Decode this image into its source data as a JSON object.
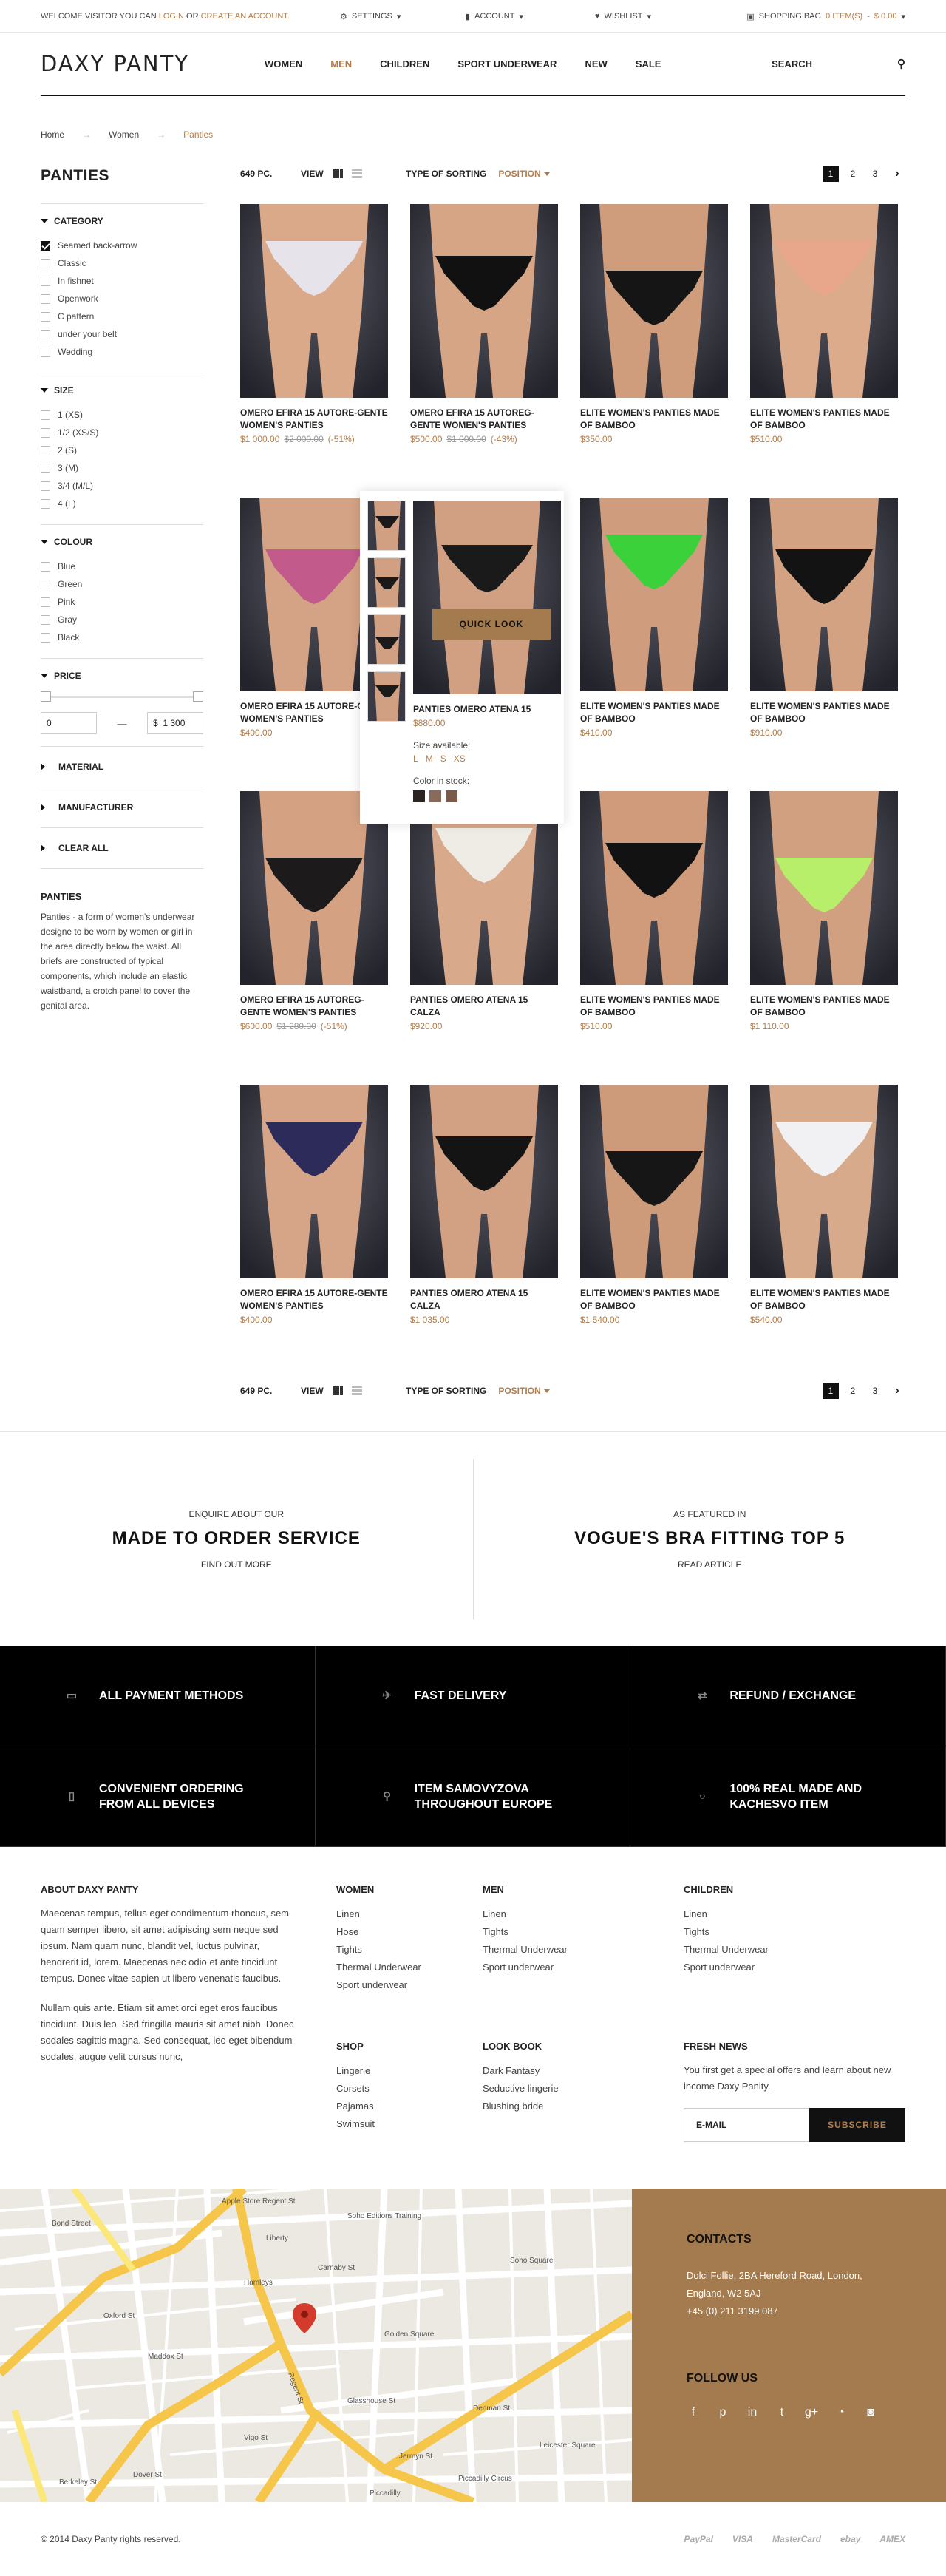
{
  "topbar": {
    "welcome_pre": "WELCOME VISITOR YOU CAN",
    "login": "LOGIN",
    "or": "OR",
    "create_account": "CREATE AN ACCOUNT.",
    "settings": "SETTINGS",
    "account": "ACCOUNT",
    "wishlist": "WISHLIST",
    "bag_label": "SHOPPING BAG",
    "bag_count": "0 ITEM(S)",
    "bag_total": "$ 0.00"
  },
  "header": {
    "logo": "DAXY PANTY",
    "nav": [
      "WOMEN",
      "MEN",
      "CHILDREN",
      "SPORT UNDERWEAR",
      "NEW",
      "SALE"
    ],
    "search": "SEARCH"
  },
  "breadcrumb": [
    "Home",
    "Women",
    "Panties"
  ],
  "sidebar": {
    "title": "PANTIES",
    "category": {
      "title": "CATEGORY",
      "items": [
        "Seamed back-arrow",
        "Classic",
        "In fishnet",
        "Openwork",
        "C pattern",
        "under your belt",
        "Wedding"
      ]
    },
    "size": {
      "title": "SIZE",
      "items": [
        "1 (XS)",
        "1/2 (XS/S)",
        "2 (S)",
        "3 (M)",
        "3/4 (M/L)",
        "4 (L)"
      ]
    },
    "colour": {
      "title": "COLOUR",
      "items": [
        "Blue",
        "Green",
        "Pink",
        "Gray",
        "Black"
      ]
    },
    "price": {
      "title": "PRICE",
      "min": "0",
      "max_currency": "$",
      "max": "1 300"
    },
    "material": "MATERIAL",
    "manufacturer": "MANUFACTURER",
    "clear": "CLEAR ALL",
    "about_title": "PANTIES",
    "about_text": "Panties - a form of women's underwear designe to be worn by women or girl in the area directly below the waist. All briefs are constructed of typical components, which include an elastic waistband, a crotch panel to cover the genital area."
  },
  "toolbar": {
    "count": "649 PC.",
    "view": "VIEW",
    "sort_label": "TYPE OF SORTING",
    "sort_value": "POSITION",
    "pages": [
      "1",
      "2",
      "3"
    ],
    "next": "›"
  },
  "products": [
    {
      "name": "OMERO EFIRA 15 AUTORE-GENTE WOMEN'S PANTIES",
      "price": "$1 000.00",
      "old": "$2 000.00",
      "disc": "(-51%)",
      "color": "#e7e3ea",
      "skin": "#d9a98a"
    },
    {
      "name": "OMERO EFIRA 15 AUTOREG-GENTE WOMEN'S PANTIES",
      "price": "$500.00",
      "old": "$1 000.00",
      "disc": "(-43%)",
      "color": "#111111",
      "skin": "#d6a586"
    },
    {
      "name": "ELITE WOMEN'S PANTIES MADE OF BAMBOO",
      "price": "$350.00",
      "old": "",
      "disc": "",
      "color": "#151515",
      "skin": "#cf9c7c"
    },
    {
      "name": "ELITE WOMEN'S PANTIES MADE OF BAMBOO",
      "price": "$510.00",
      "old": "",
      "disc": "",
      "color": "#e8a78b",
      "skin": "#dcab8c"
    },
    {
      "name": "OMERO EFIRA 15 AUTORE-GENTE WOMEN'S PANTIES",
      "price": "$400.00",
      "old": "",
      "disc": "",
      "color": "#c25a8c",
      "skin": "#d4a385"
    },
    {
      "name": "PANTIES OMERO ATENA 15",
      "price": "$880.00",
      "old": "",
      "disc": "",
      "color": "#1a1a1a",
      "skin": "#d1a082"
    },
    {
      "name": "ELITE WOMEN'S PANTIES MADE OF BAMBOO",
      "price": "$410.00",
      "old": "",
      "disc": "",
      "color": "#3bd13b",
      "skin": "#cf9d7e"
    },
    {
      "name": "ELITE WOMEN'S PANTIES MADE OF BAMBOO",
      "price": "$910.00",
      "old": "",
      "disc": "",
      "color": "#131313",
      "skin": "#d2a283"
    },
    {
      "name": "OMERO EFIRA 15 AUTOREG-GENTE WOMEN'S PANTIES",
      "price": "$600.00",
      "old": "$1 280.00",
      "disc": "(-51%)",
      "color": "#1d1a1c",
      "skin": "#d4a283"
    },
    {
      "name": "PANTIES OMERO ATENA 15 CALZA",
      "price": "$920.00",
      "old": "",
      "disc": "",
      "color": "#efece6",
      "skin": "#d8a98b"
    },
    {
      "name": "ELITE WOMEN'S PANTIES MADE OF BAMBOO",
      "price": "$510.00",
      "old": "",
      "disc": "",
      "color": "#121212",
      "skin": "#cf9b7b"
    },
    {
      "name": "ELITE WOMEN'S PANTIES MADE OF BAMBOO",
      "price": "$1 110.00",
      "old": "",
      "disc": "",
      "color": "#b8ef6a",
      "skin": "#d1a081"
    },
    {
      "name": "OMERO EFIRA 15 AUTORE-GENTE WOMEN'S PANTIES",
      "price": "$400.00",
      "old": "",
      "disc": "",
      "color": "#2c2b5a",
      "skin": "#d6a587"
    },
    {
      "name": "PANTIES OMERO ATENA 15 CALZA",
      "price": "$1 035.00",
      "old": "",
      "disc": "",
      "color": "#141414",
      "skin": "#d2a083"
    },
    {
      "name": "ELITE WOMEN'S PANTIES MADE OF BAMBOO",
      "price": "$1 540.00",
      "old": "",
      "disc": "",
      "color": "#161616",
      "skin": "#cd9a7a"
    },
    {
      "name": "ELITE WOMEN'S PANTIES MADE OF BAMBOO",
      "price": "$540.00",
      "old": "",
      "disc": "",
      "color": "#f1f1f4",
      "skin": "#d8aa8c"
    }
  ],
  "quicklook": {
    "button": "QUICK LOOK",
    "name": "PANTIES OMERO ATENA 15",
    "price": "$880.00",
    "size_label": "Size available:",
    "sizes": [
      "L",
      "M",
      "S",
      "XS"
    ],
    "color_label": "Color in stock:",
    "colors": [
      "#2a2522",
      "#8a6a5a",
      "#7a5a48"
    ]
  },
  "promo": [
    {
      "small": "ENQUIRE ABOUT OUR",
      "big": "MADE TO ORDER SERVICE",
      "link": "FIND OUT MORE"
    },
    {
      "small": "AS FEATURED IN",
      "big": "VOGUE'S BRA FITTING TOP 5",
      "link": "READ ARTICLE"
    }
  ],
  "features": [
    {
      "text": "ALL PAYMENT METHODS",
      "icon": "card-icon"
    },
    {
      "text": "FAST DELIVERY",
      "icon": "plane-icon"
    },
    {
      "text": "REFUND / EXCHANGE",
      "icon": "exchange-icon"
    },
    {
      "text": "CONVENIENT ORDERING FROM ALL DEVICES",
      "icon": "mobile-icon"
    },
    {
      "text": "ITEM SAMOVYZOVA THROUGHOUT EUROPE",
      "icon": "map-pin-icon"
    },
    {
      "text": "100% REAL MADE AND KACHESVO ITEM",
      "icon": "circle-icon"
    }
  ],
  "footer": {
    "about_title": "ABOUT DAXY PANTY",
    "about_p1": "Maecenas tempus, tellus eget condimentum rhoncus, sem quam semper libero, sit amet adipiscing sem neque sed ipsum. Nam quam nunc, blandit vel, luctus pulvinar, hendrerit id, lorem. Maecenas nec odio et ante tincidunt tempus. Donec vitae sapien ut libero venenatis faucibus.",
    "about_p2": "Nullam quis ante. Etiam sit amet orci eget eros faucibus tincidunt. Duis leo. Sed fringilla mauris sit amet nibh. Donec sodales sagittis magna. Sed consequat, leo eget bibendum sodales, augue velit cursus nunc,",
    "women": {
      "title": "WOMEN",
      "items": [
        "Linen",
        "Hose",
        "Tights",
        "Thermal Underwear",
        "Sport underwear"
      ]
    },
    "men": {
      "title": "MEN",
      "items": [
        "Linen",
        "Tights",
        "Thermal Underwear",
        "Sport underwear"
      ]
    },
    "children": {
      "title": "CHILDREN",
      "items": [
        "Linen",
        "Tights",
        "Thermal Underwear",
        "Sport underwear"
      ]
    },
    "shop": {
      "title": "SHOP",
      "items": [
        "Lingerie",
        "Corsets",
        "Pajamas",
        "Swimsuit"
      ]
    },
    "lookbook": {
      "title": "LOOK BOOK",
      "items": [
        "Dark Fantasy",
        "Seductive lingerie",
        "Blushing bride"
      ]
    },
    "news_title": "FRESH NEWS",
    "news_text": "You first get a special offers and learn about new income Daxy Panity.",
    "email_placeholder": "E-MAIL",
    "subscribe": "SUBSCRIBE"
  },
  "contacts": {
    "title": "CONTACTS",
    "address": "Dolci Follie, 2BA Hereford Road, London, England, W2 5AJ",
    "phone": "+45 (0) 211 3199 087",
    "follow": "FOLLOW US"
  },
  "map": {
    "labels": [
      "Apple Store Regent St",
      "Soho Editions Training",
      "Liberty",
      "Hamleys",
      "Carnaby St",
      "Piccadilly Circus",
      "Regent St",
      "Bond Street",
      "Golden Square",
      "Piccadilly",
      "Leicester Square",
      "Oxford St",
      "Soho Square",
      "Denman St",
      "Glasshouse St",
      "Jermyn St",
      "Vigo St",
      "Dover St",
      "Maddox St",
      "Berkeley St"
    ]
  },
  "bottom": {
    "copyright": "© 2014 Daxy Panty rights reserved.",
    "payments": [
      "PayPal",
      "VISA",
      "MasterCard",
      "ebay",
      "AMEX"
    ]
  }
}
